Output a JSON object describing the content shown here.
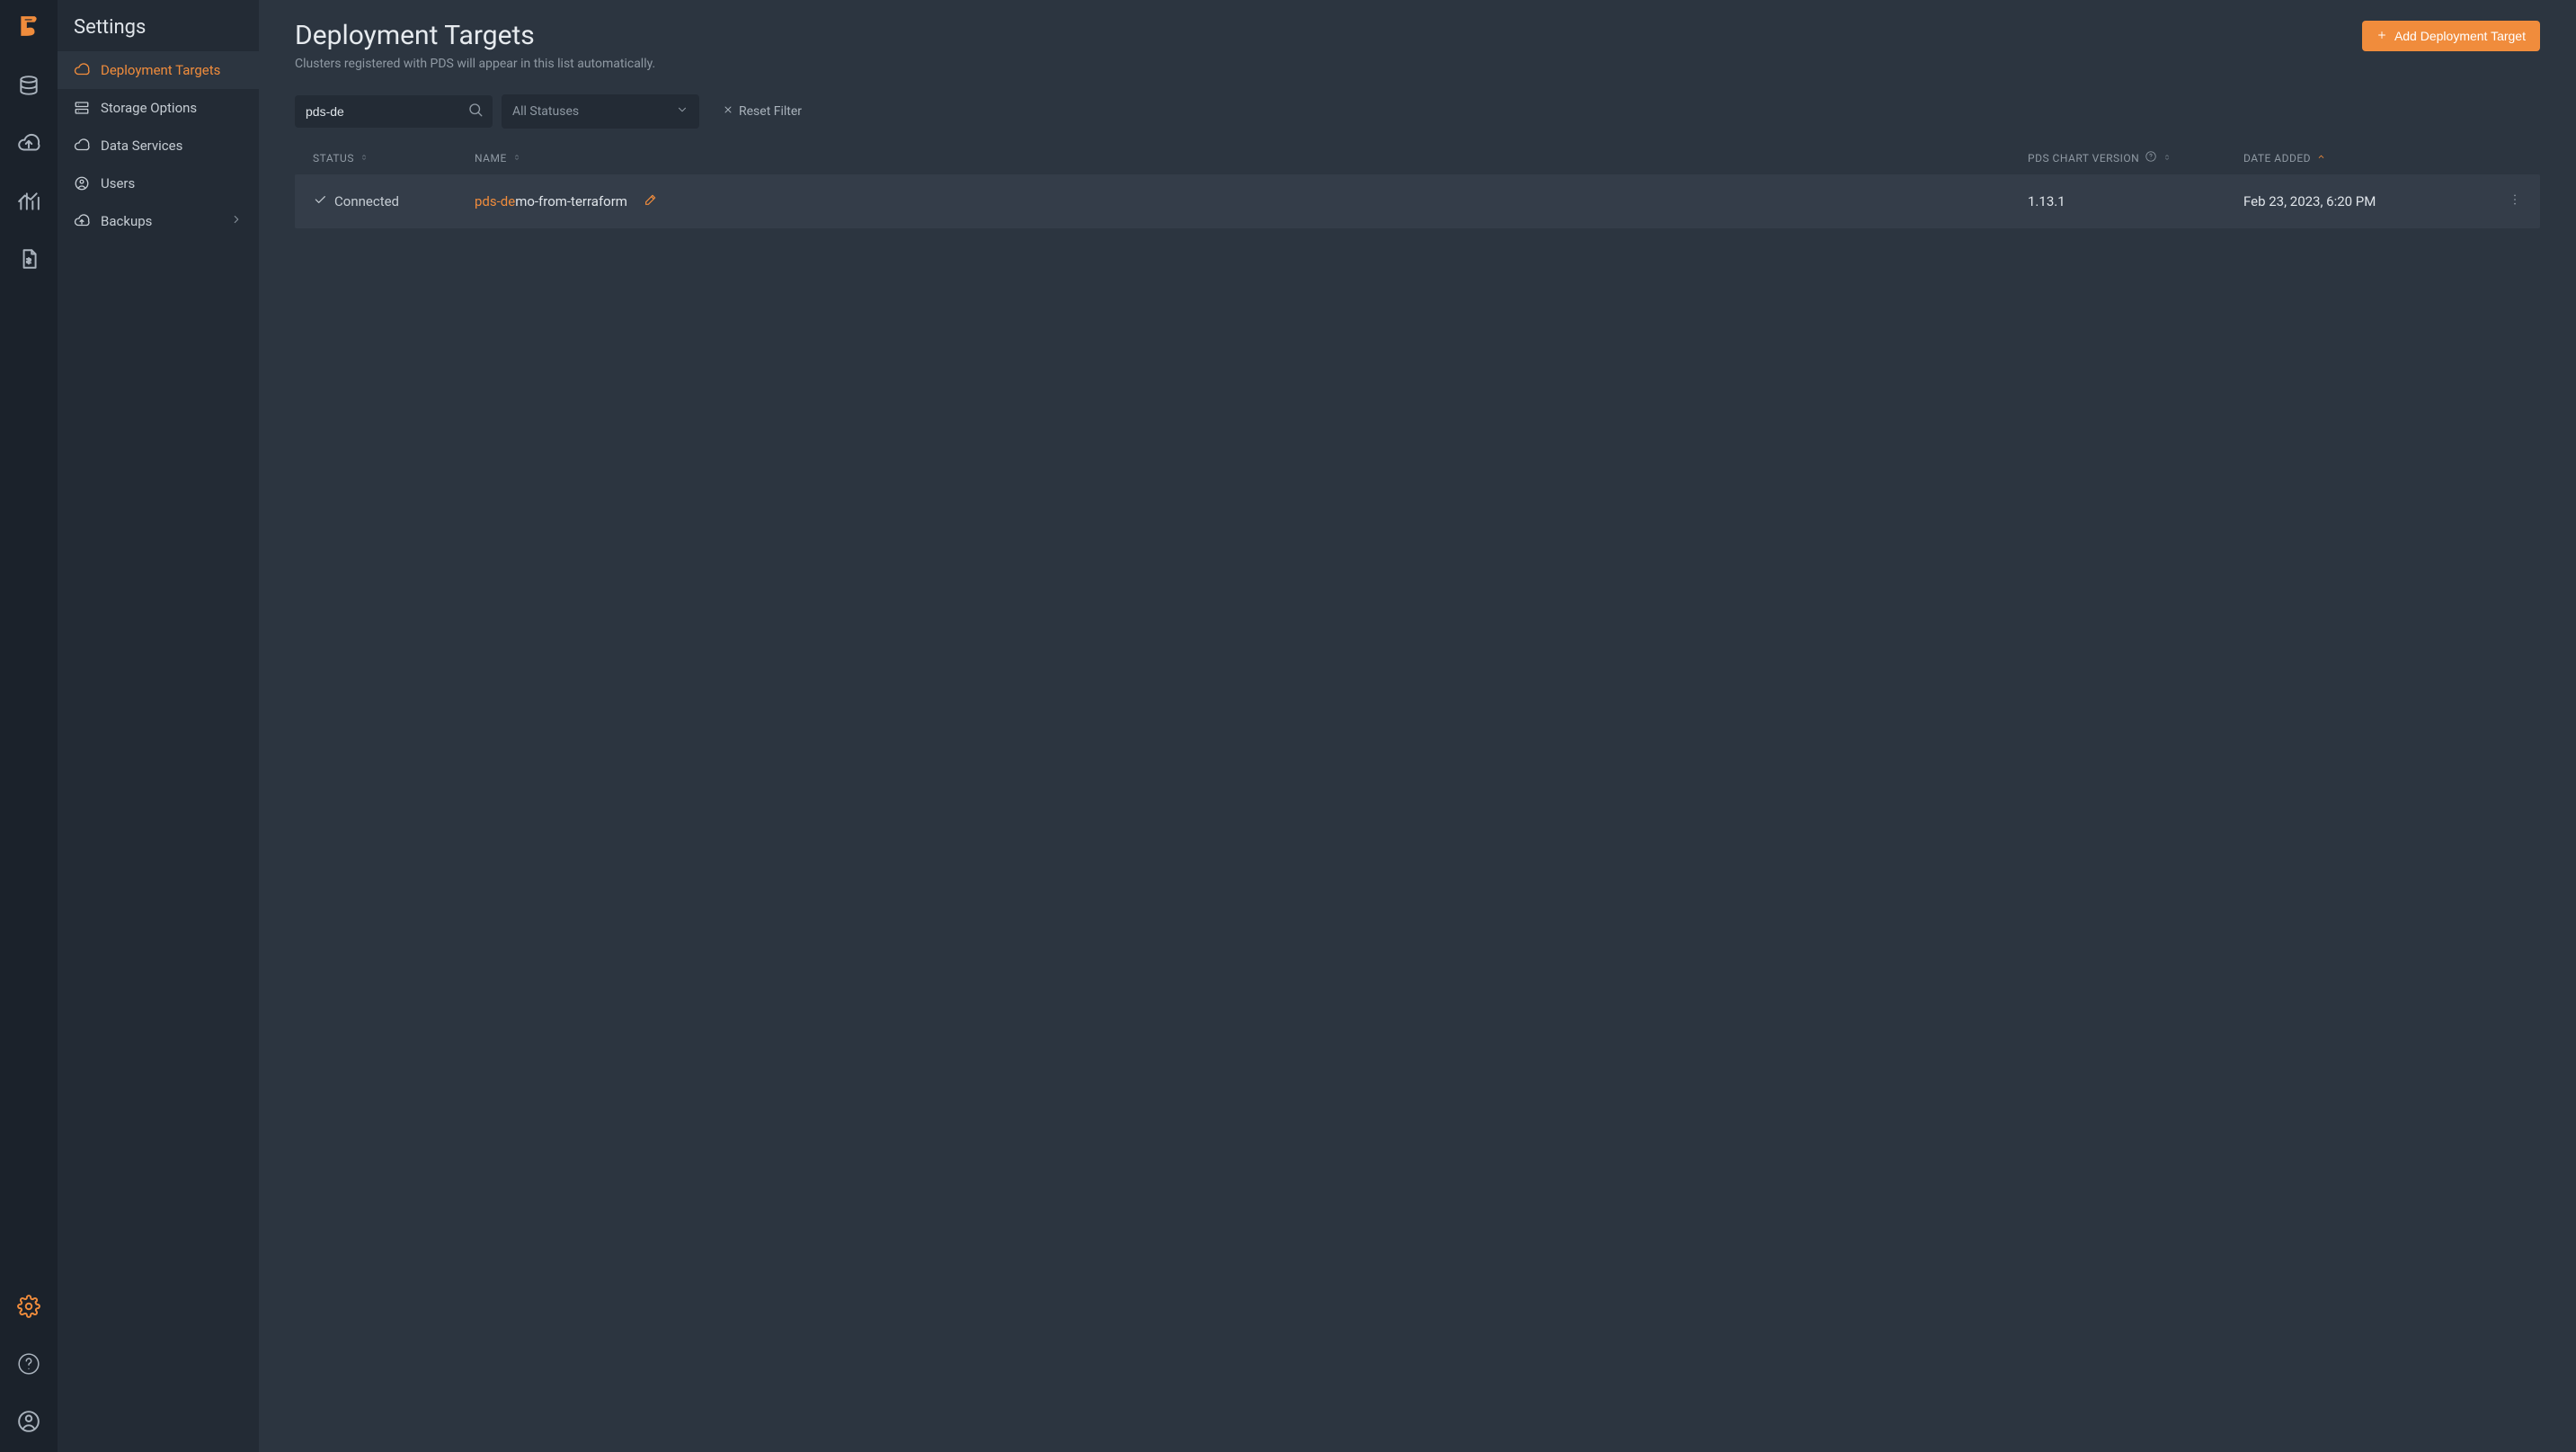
{
  "colors": {
    "accent": "#f08c3c"
  },
  "sidebar": {
    "title": "Settings",
    "items": [
      {
        "label": "Deployment Targets",
        "icon": "cloud-icon",
        "active": true
      },
      {
        "label": "Storage Options",
        "icon": "storage-icon"
      },
      {
        "label": "Data Services",
        "icon": "cloud-icon"
      },
      {
        "label": "Users",
        "icon": "user-circle-icon"
      },
      {
        "label": "Backups",
        "icon": "cloud-upload-icon",
        "chevron": true
      }
    ]
  },
  "header": {
    "title": "Deployment Targets",
    "subtitle": "Clusters registered with PDS will appear in this list automatically.",
    "add_button": "Add Deployment Target"
  },
  "filters": {
    "search_value": "pds-de",
    "status_label": "All Statuses",
    "reset_label": "Reset Filter"
  },
  "table": {
    "columns": {
      "status": "STATUS",
      "name": "NAME",
      "version": "PDS CHART VERSION",
      "date": "DATE ADDED"
    },
    "rows": [
      {
        "status": "Connected",
        "name_highlight": "pds-de",
        "name_rest": "mo-from-terraform",
        "version": "1.13.1",
        "date_added": "Feb 23, 2023, 6:20 PM"
      }
    ]
  }
}
